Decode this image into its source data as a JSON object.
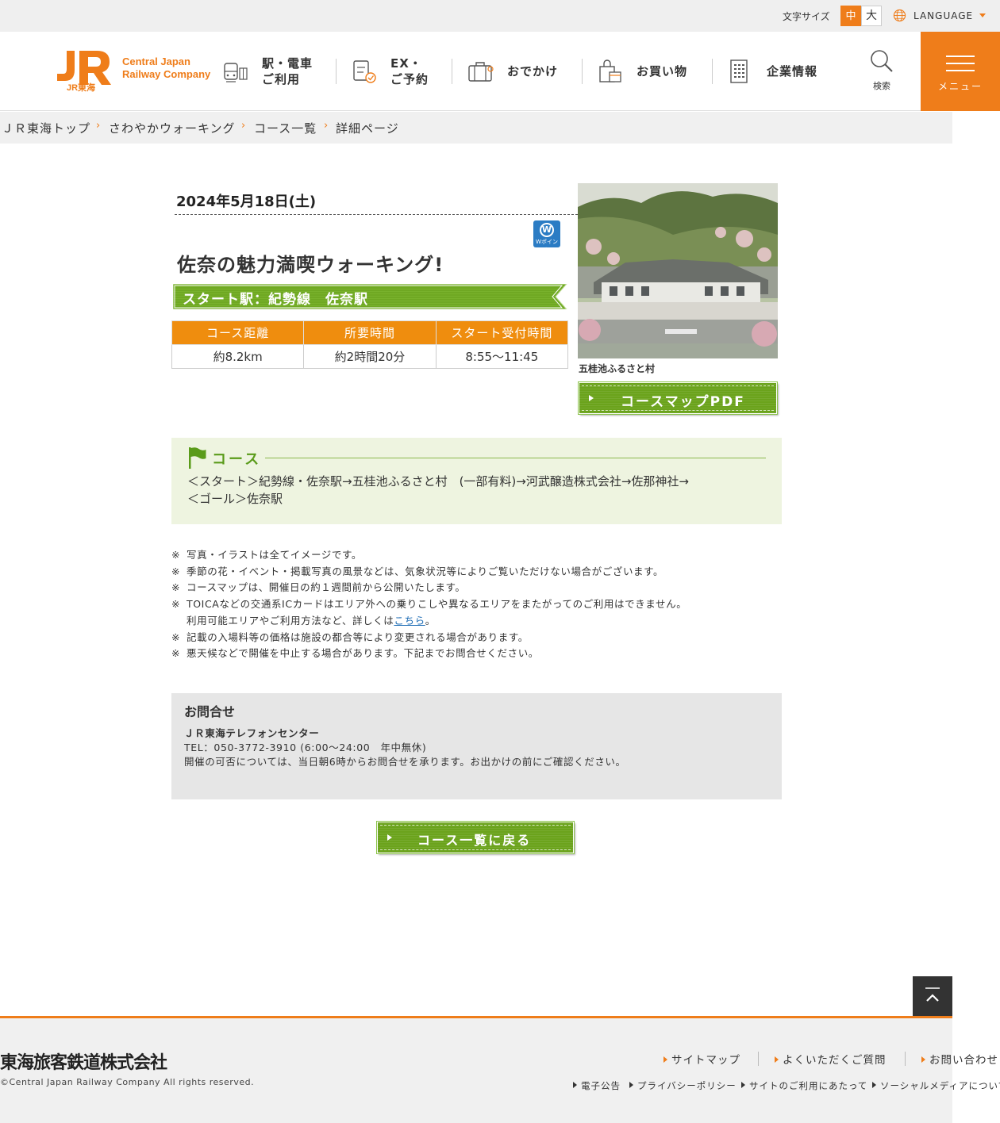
{
  "utility": {
    "font_size_label": "文字サイズ",
    "font_size_medium": "中",
    "font_size_large": "大",
    "language_label": "LANGUAGE"
  },
  "header": {
    "logo_mark": "JR",
    "logo_sub": "JR東海",
    "logo_en_line1": "Central Japan",
    "logo_en_line2": "Railway Company",
    "nav": [
      {
        "label": "駅・電車\nご利用",
        "icon": "train-station-icon"
      },
      {
        "label": "EX・\nご予約",
        "icon": "reservation-icon"
      },
      {
        "label": "おでかけ",
        "icon": "suitcase-icon"
      },
      {
        "label": "お買い物",
        "icon": "shopping-bag-icon"
      },
      {
        "label": "企業情報",
        "icon": "building-icon"
      }
    ],
    "search_label": "検索",
    "menu_label": "メニュー",
    "accent_color": "#ef7d1a"
  },
  "breadcrumb": [
    "ＪＲ東海トップ",
    "さわやかウォーキング",
    "コース一覧",
    "詳細ページ"
  ],
  "event": {
    "date": "2024年5月18日(土)",
    "badge_symbol": "W",
    "badge_text": "Wポイント",
    "title": "佐奈の魅力満喫ウォーキング!",
    "start_station": "スタート駅：紀勢線　佐奈駅",
    "table_headers": [
      "コース距離",
      "所要時間",
      "スタート受付時間"
    ],
    "table_values": [
      "約8.2km",
      "約2時間20分",
      "8:55〜11:45"
    ],
    "photo_caption": "五桂池ふるさと村",
    "map_button": "コースマップPDF"
  },
  "course": {
    "heading": "コース",
    "route_line1": "＜スタート＞紀勢線・佐奈駅→五桂池ふるさと村　(一部有料)→河武醸造株式会社→佐那神社→",
    "route_line2": "＜ゴール＞佐奈駅"
  },
  "notes": {
    "mark": "※",
    "items": [
      "写真・イラストは全てイメージです。",
      "季節の花・イベント・掲載写真の風景などは、気象状況等によりご覧いただけない場合がございます。",
      "コースマップは、開催日の約１週間前から公開いたします。",
      "TOICAなどの交通系ICカードはエリア外への乗りこしや異なるエリアをまたがってのご利用はできません。"
    ],
    "toica_cont_pre": "利用可能エリアやご利用方法など、詳しくは",
    "toica_link": "こちら",
    "toica_cont_post": "。",
    "items2": [
      "記載の入場料等の価格は施設の都合等により変更される場合があります。",
      "悪天候などで開催を中止する場合があります。下記までお問合せください。"
    ]
  },
  "contact": {
    "heading": "お問合せ",
    "center": "ＪＲ東海テレフォンセンター",
    "tel": "TEL：050-3772-3910 (6:00〜24:00　年中無休)",
    "note": "開催の可否については、当日朝6時からお問合せを承ります。お出かけの前にご確認ください。"
  },
  "back_button": "コース一覧に戻る",
  "footer": {
    "company": "東海旅客鉄道株式会社",
    "copyright": "©Central Japan Railway Company All rights reserved.",
    "links": [
      "サイトマップ",
      "よくいただくご質問",
      "お問い合わせ"
    ],
    "sub_links": [
      "電子公告",
      "プライバシーポリシー",
      "サイトのご利用にあたって",
      "ソーシャルメディアについて"
    ]
  }
}
